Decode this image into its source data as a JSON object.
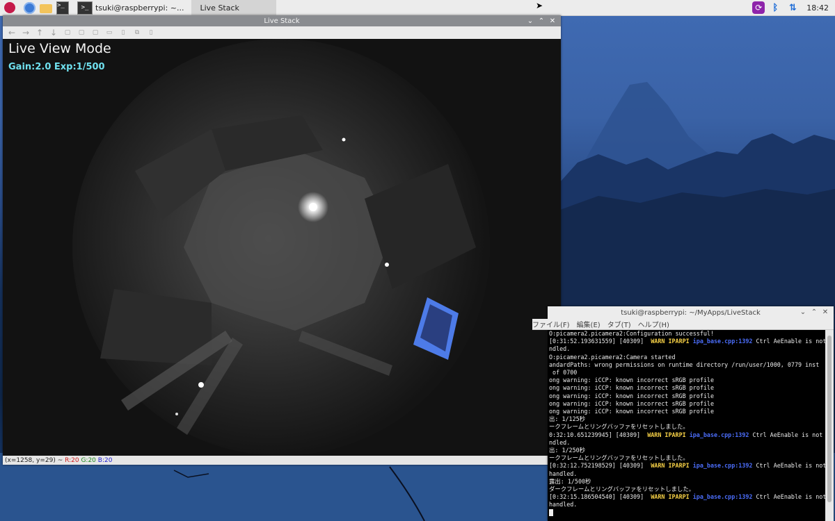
{
  "taskbar": {
    "terminal_task_label": "tsuki@raspberrypi: ~...",
    "livestack_task_label": "Live Stack",
    "clock": "18:42",
    "icons": [
      "raspberry-pi-logo",
      "web-browser-icon",
      "file-manager-icon",
      "terminal-icon",
      "update-icon",
      "bluetooth-icon",
      "network-icon"
    ]
  },
  "livestack_window": {
    "title": "Live Stack",
    "toolbar": [
      "back-arrow",
      "forward-arrow",
      "up-arrow",
      "down-arrow",
      "home",
      "zoom-in",
      "zoom-out",
      "zoom-fit",
      "save",
      "copy",
      "settings"
    ],
    "overlay_title": "Live View Mode",
    "overlay_params": "Gain:2.0 Exp:1/500",
    "status": {
      "coords": "(x=1258, y=29) ~ ",
      "r": "R:20",
      "g": "G:20",
      "b": "B:20"
    }
  },
  "terminal_window": {
    "title": "tsuki@raspberrypi: ~/MyApps/LiveStack",
    "menu": [
      "ファイル(F)",
      "編集(E)",
      "タブ(T)",
      "ヘルプ(H)"
    ],
    "lines": [
      {
        "text": "O:picamera2.picamera2:Configuration successful!"
      },
      {
        "pre": "[0:31:52.193631559] [40309]  ",
        "warn": "WARN IPARPI ",
        "file": "ipa_base.cpp:1392",
        "post": " Ctrl AeEnable is not"
      },
      {
        "text": "ndled."
      },
      {
        "text": "O:picamera2.picamera2:Camera started"
      },
      {
        "text": "andardPaths: wrong permissions on runtime directory /run/user/1000, 0779 inst"
      },
      {
        "text": " of 0700"
      },
      {
        "text": "ong warning: iCCP: known incorrect sRGB profile"
      },
      {
        "text": "ong warning: iCCP: known incorrect sRGB profile"
      },
      {
        "text": "ong warning: iCCP: known incorrect sRGB profile"
      },
      {
        "text": "ong warning: iCCP: known incorrect sRGB profile"
      },
      {
        "text": "ong warning: iCCP: known incorrect sRGB profile"
      },
      {
        "text": "出: 1/125秒"
      },
      {
        "text": "ークフレームとリングバッファをリセットしました。"
      },
      {
        "pre": "0:32:10.651239945] [40309]  ",
        "warn": "WARN IPARPI ",
        "file": "ipa_base.cpp:1392",
        "post": " Ctrl AeEnable is not"
      },
      {
        "text": "ndled."
      },
      {
        "text": "出: 1/250秒"
      },
      {
        "text": "ークフレームとリングバッファをリセットしました。"
      },
      {
        "pre": "[0:32:12.752198529] [40309]  ",
        "warn": "WARN IPARPI ",
        "file": "ipa_base.cpp:1392",
        "post": " Ctrl AeEnable is not"
      },
      {
        "text": "handled."
      },
      {
        "text": "露出: 1/500秒"
      },
      {
        "text": "ダークフレームとリングバッファをリセットしました。"
      },
      {
        "pre": "[0:32:15.186504540] [40309]  ",
        "warn": "WARN IPARPI ",
        "file": "ipa_base.cpp:1392",
        "post": " Ctrl AeEnable is not"
      },
      {
        "text": "handled."
      }
    ]
  }
}
